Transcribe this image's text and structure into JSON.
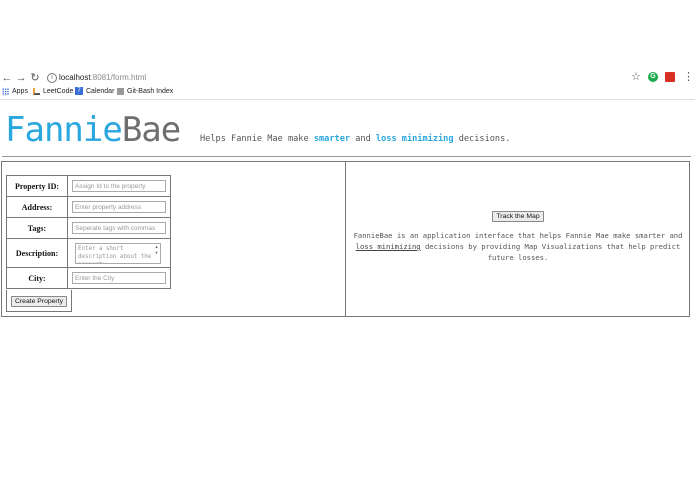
{
  "browser": {
    "url_host": "localhost",
    "url_rest": ":8081/form.html",
    "bookmarks": [
      "Apps",
      "LeetCode",
      "Calendar",
      "Git-Bash Index"
    ]
  },
  "header": {
    "brand_part1": "Fannie",
    "brand_part2": "Bae",
    "tagline_pre": "Helps Fannie Mae make ",
    "tagline_b1": "smarter",
    "tagline_mid": " and ",
    "tagline_b2": "loss minimizing",
    "tagline_post": " decisions."
  },
  "form": {
    "fields": [
      {
        "label": "Property ID:",
        "placeholder": "Assign Id to the property"
      },
      {
        "label": "Address:",
        "placeholder": "Enter property address"
      },
      {
        "label": "Tags:",
        "placeholder": "Seperate tags with commas"
      },
      {
        "label": "Description:",
        "placeholder": "Enter a short description about the property"
      },
      {
        "label": "City:",
        "placeholder": "Enter the City"
      }
    ],
    "submit_label": "Create Property"
  },
  "panel": {
    "track_label": "Track the Map",
    "desc_pre": "FannieBae is an application interface that helps Fannie Mae make smarter and ",
    "desc_link": "loss minimizing",
    "desc_post": " decisions by providing Map Visualizations that help predict future losses."
  },
  "colors": {
    "brand_blue": "#2aa7df",
    "brand_grey": "#6e6e6e"
  }
}
